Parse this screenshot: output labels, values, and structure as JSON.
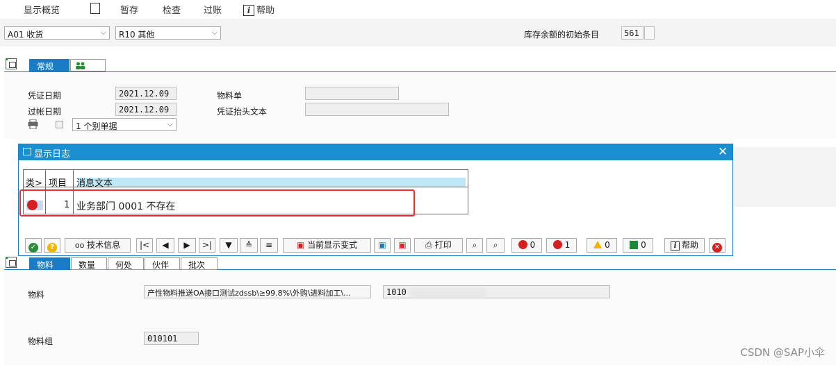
{
  "toolbar": {
    "overview": "显示概览",
    "hold": "暂存",
    "check": "检查",
    "post": "过账",
    "help": "帮助"
  },
  "header": {
    "action_select": "A01 收货",
    "ref_select": "R10 其他",
    "stock_label": "库存余额的初始条目",
    "movement_type": "561"
  },
  "tabs_top": {
    "general": "常规"
  },
  "general": {
    "doc_date_label": "凭证日期",
    "doc_date": "2021.12.09",
    "post_date_label": "过帐日期",
    "post_date": "2021.12.09",
    "print_option": "1 个别单据",
    "material_slip_label": "物料单",
    "header_text_label": "凭证抬头文本"
  },
  "dialog": {
    "title": "显示日志",
    "columns": [
      "类>",
      "项目",
      "消息文本"
    ],
    "rows": [
      {
        "item": "1",
        "text": "业务部门 0001   不存在"
      }
    ],
    "buttons": {
      "tech_info": "技术信息",
      "current_variant": "当前显示变式",
      "print": "打印",
      "stop_count": "0",
      "error_count": "1",
      "warning_count": "0",
      "success_count": "0",
      "help": "帮助"
    }
  },
  "item_tabs": [
    "物料",
    "数量",
    "何处",
    "伙伴",
    "批次"
  ],
  "item": {
    "material_label": "物料",
    "material_desc": "产性物料推送OA接口测试zdssb\\≥99.8%\\外购\\进料加工\\...",
    "material_code": "1010",
    "material_group_label": "物料组",
    "material_group": "010101"
  },
  "watermark": "CSDN @SAP小伞",
  "colors": {
    "accent": "#1a7cc4",
    "dialog_title": "#1a8fd0",
    "error": "#d42020",
    "highlight_row": "#bfe7f5",
    "red_box": "#e0312b"
  }
}
